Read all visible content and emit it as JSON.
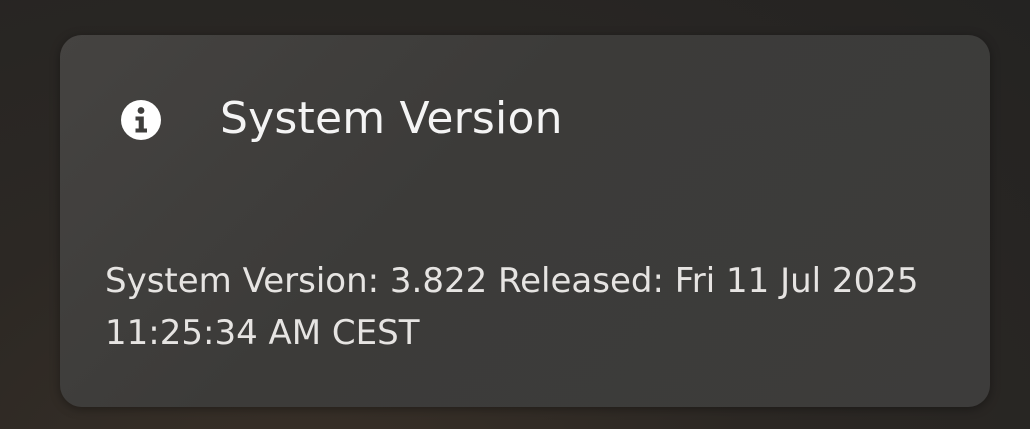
{
  "card": {
    "title": "System Version",
    "icon": "info-icon",
    "message": "System Version: 3.822 Released: Fri 11 Jul 2025 11:25:34 AM CEST"
  }
}
